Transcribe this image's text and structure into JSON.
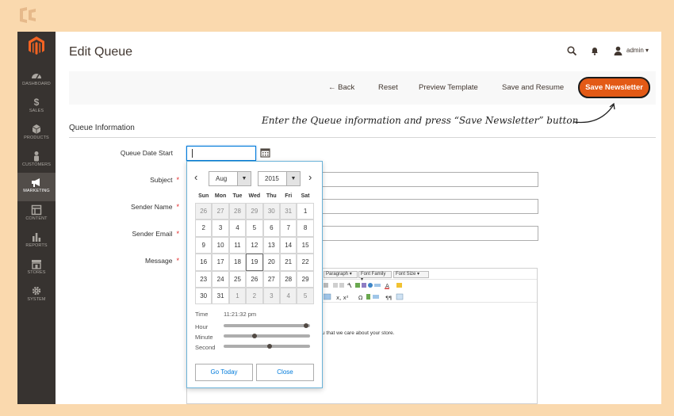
{
  "app": {
    "sidebar": {
      "items": [
        {
          "label": "DASHBOARD",
          "icon": "dashboard-icon"
        },
        {
          "label": "SALES",
          "icon": "dollar-icon"
        },
        {
          "label": "PRODUCTS",
          "icon": "cube-icon"
        },
        {
          "label": "CUSTOMERS",
          "icon": "person-icon"
        },
        {
          "label": "MARKETING",
          "icon": "megaphone-icon",
          "active": true
        },
        {
          "label": "CONTENT",
          "icon": "layout-icon"
        },
        {
          "label": "REPORTS",
          "icon": "bar-chart-icon"
        },
        {
          "label": "STORES",
          "icon": "store-icon"
        },
        {
          "label": "SYSTEM",
          "icon": "gear-icon"
        }
      ]
    },
    "header": {
      "title": "Edit Queue",
      "user": "admin ▾"
    },
    "actions": {
      "back": "← Back",
      "reset": "Reset",
      "preview": "Preview Template",
      "save_resume": "Save and Resume",
      "save_newsletter": "Save Newsletter"
    },
    "annotation": "Enter the Queue information and press “Save Newsletter” button",
    "form": {
      "section_title": "Queue Information",
      "queue_date_label": "Queue Date Start",
      "subject_label": "Subject",
      "sender_name_label": "Sender Name",
      "sender_email_label": "Sender Email",
      "message_label": "Message",
      "required_mark": "*",
      "editor": {
        "paragraph": "Paragraph",
        "font_family": "Font Family",
        "font_size": "Font Size",
        "body_snippet": "u that we care about your store."
      }
    },
    "calendar": {
      "month": "Aug",
      "year": "2015",
      "prev": "‹",
      "next": "›",
      "weekdays": [
        "Sun",
        "Mon",
        "Tue",
        "Wed",
        "Thu",
        "Fri",
        "Sat"
      ],
      "days": [
        [
          "26",
          "27",
          "28",
          "29",
          "30",
          "31",
          "1"
        ],
        [
          "2",
          "3",
          "4",
          "5",
          "6",
          "7",
          "8"
        ],
        [
          "9",
          "10",
          "11",
          "12",
          "13",
          "14",
          "15"
        ],
        [
          "16",
          "17",
          "18",
          "19",
          "20",
          "21",
          "22"
        ],
        [
          "23",
          "24",
          "25",
          "26",
          "27",
          "28",
          "29"
        ],
        [
          "30",
          "31",
          "1",
          "2",
          "3",
          "4",
          "5"
        ]
      ],
      "time_label": "Time",
      "time_value": "11:21:32 pm",
      "hour_label": "Hour",
      "minute_label": "Minute",
      "second_label": "Second",
      "hour_fraction": 0.98,
      "minute_fraction": 0.35,
      "second_fraction": 0.53,
      "go_today": "Go Today",
      "close": "Close"
    },
    "colors": {
      "accent": "#e35a16",
      "sidebar": "#373330",
      "background": "#fad9ae",
      "link": "#007bdb"
    }
  }
}
